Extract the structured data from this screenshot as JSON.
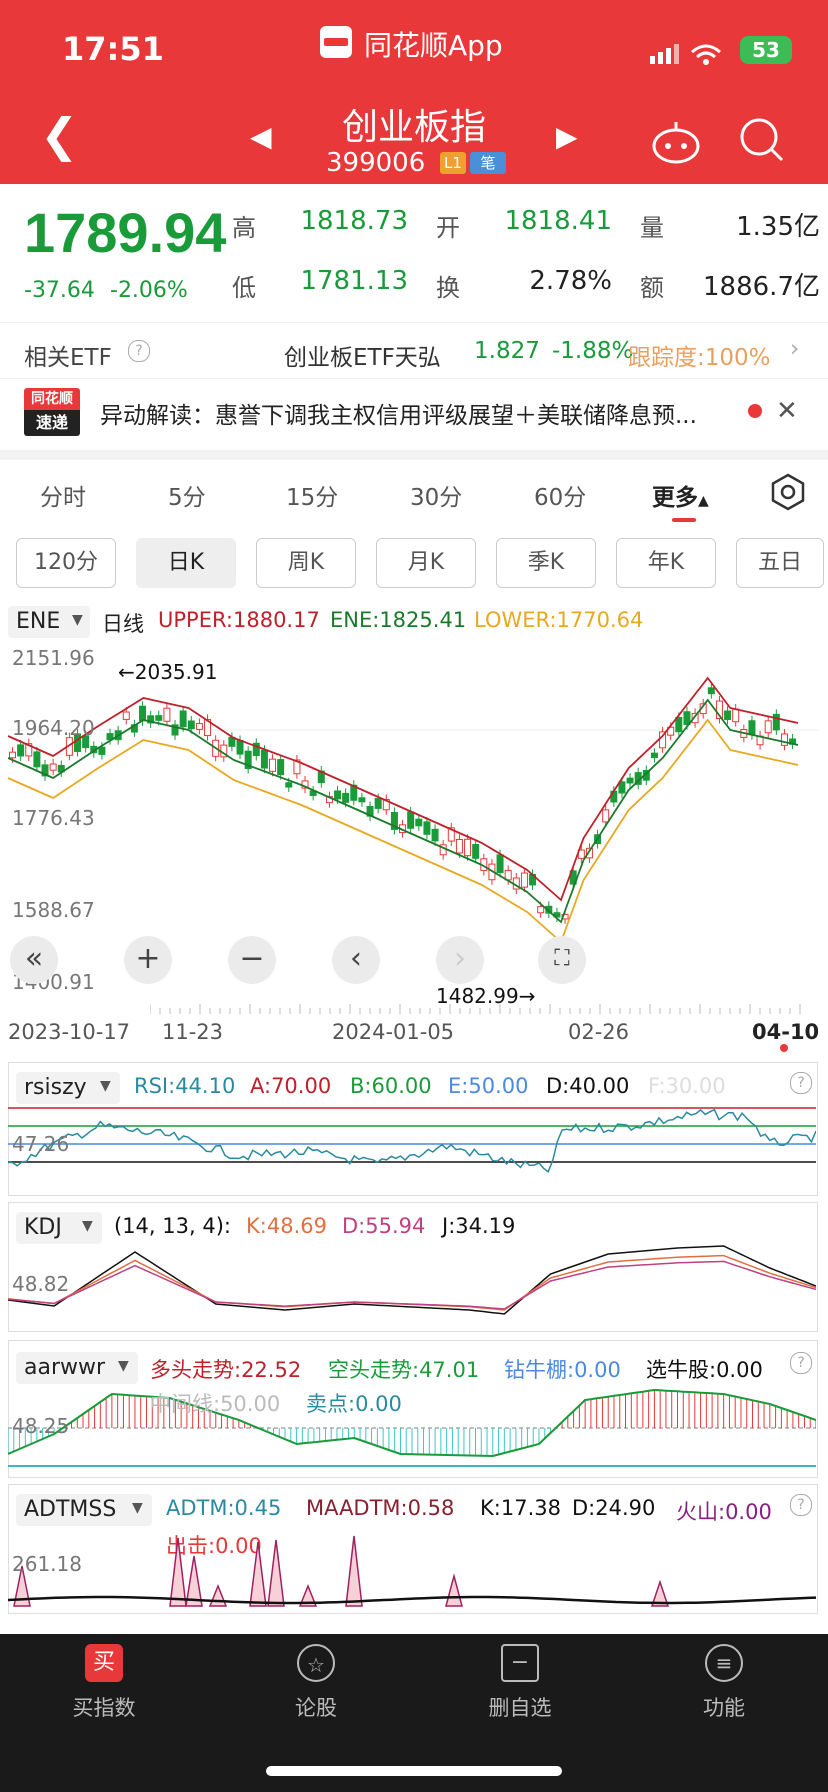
{
  "status": {
    "time": "17:51",
    "battery": "53"
  },
  "app": {
    "name": "同花顺App"
  },
  "header": {
    "title": "创业板指",
    "code": "399006",
    "badge_l": "L1",
    "badge_b": "笔"
  },
  "quote": {
    "price": "1789.94",
    "change": "-37.64",
    "change_pct": "-2.06%",
    "high_label": "高",
    "high": "1818.73",
    "open_label": "开",
    "open": "1818.41",
    "vol_label": "量",
    "vol": "1.35亿",
    "low_label": "低",
    "low": "1781.13",
    "turn_label": "换",
    "turn": "2.78%",
    "amt_label": "额",
    "amt": "1886.7亿"
  },
  "etf": {
    "label": "相关ETF",
    "name": "创业板ETF天弘",
    "price": "1.827",
    "pct": "-1.88%",
    "track": "跟踪度:100%"
  },
  "news": {
    "logo1": "同花顺",
    "logo2": "速递",
    "text": "异动解读：惠誉下调我主权信用评级展望＋美联储降息预..."
  },
  "tabs": [
    "分时",
    "5分",
    "15分",
    "30分",
    "60分",
    "更多"
  ],
  "ktabs": [
    "120分",
    "日K",
    "周K",
    "月K",
    "季K",
    "年K",
    "五日"
  ],
  "ene": {
    "name": "ENE",
    "period": "日线",
    "upper": "UPPER:1880.17",
    "ene": "ENE:1825.41",
    "lower": "LOWER:1770.64",
    "y1": "2151.96",
    "y2": "1964.20",
    "y3": "1776.43",
    "y4": "1588.67",
    "y5": "1400.91",
    "high_mark": "←2035.91",
    "low_mark": "1482.99→",
    "dates": [
      "2023-10-17",
      "11-23",
      "2024-01-05",
      "02-26",
      "04-10"
    ]
  },
  "rsi": {
    "name": "rsiszy",
    "rsi": "RSI:44.10",
    "a": "A:70.00",
    "b": "B:60.00",
    "e": "E:50.00",
    "d": "D:40.00",
    "f": "F:30.00",
    "y": "47.26"
  },
  "kdj": {
    "name": "KDJ",
    "params": "(14, 13, 4):",
    "k": "K:48.69",
    "d": "D:55.94",
    "j": "J:34.19",
    "y": "48.82"
  },
  "aar": {
    "name": "aarwwr",
    "bull": "多头走势:22.52",
    "bear": "空头走势:47.01",
    "drill": "钻牛棚:0.00",
    "pick": "选牛股:0.00",
    "mid": "中间线:50.00",
    "sell": "卖点:0.00",
    "y": "48.25"
  },
  "adt": {
    "name": "ADTMSS",
    "adtm": "ADTM:0.45",
    "ma": "MAADTM:0.58",
    "k": "K:17.38",
    "d": "D:24.90",
    "vol": "火山:0.00",
    "out": "出击:0.00",
    "y": "261.18"
  },
  "bottom": [
    "买指数",
    "论股",
    "删自选",
    "功能"
  ],
  "colors": {
    "red": "#e8383a",
    "green": "#1a9b3a",
    "upper": "#c0202a",
    "ene": "#1a7a2a",
    "lower": "#e8a820"
  }
}
